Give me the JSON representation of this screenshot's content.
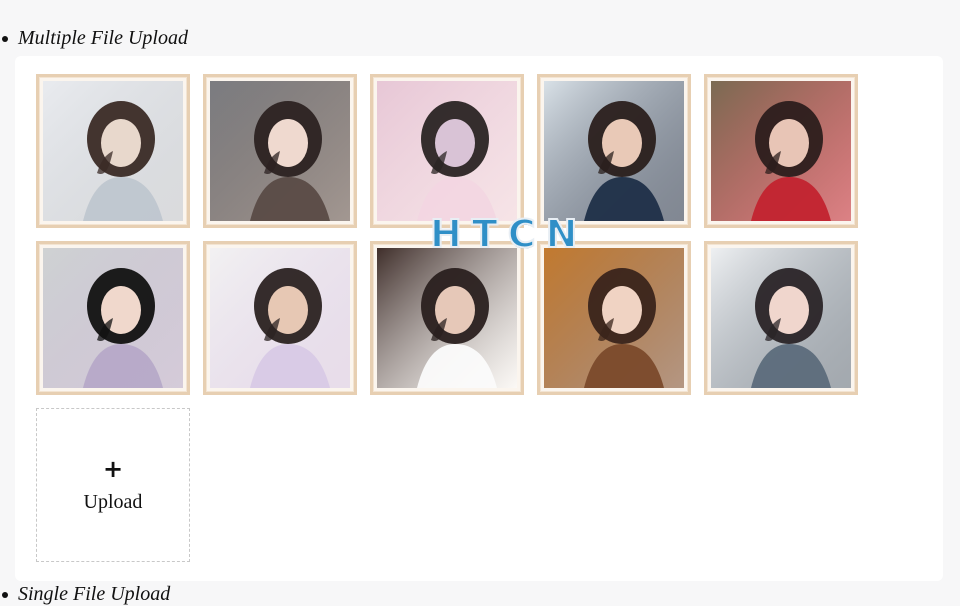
{
  "sections": {
    "multiple": {
      "title": "Multiple File Upload"
    },
    "single": {
      "title": "Single File Upload"
    }
  },
  "gallery": {
    "items": [
      {
        "name": "photo-1",
        "colors": [
          "#e9ebef",
          "#bfc6cf",
          "#3a2a25",
          "#e8d8cc"
        ]
      },
      {
        "name": "photo-2",
        "colors": [
          "#7b7c80",
          "#5a4b46",
          "#2c2221",
          "#efd9cf"
        ]
      },
      {
        "name": "photo-3",
        "colors": [
          "#e7c7d6",
          "#f2d6e1",
          "#2a2423",
          "#d9c3d6"
        ]
      },
      {
        "name": "photo-4",
        "colors": [
          "#d9e1e7",
          "#1f2f48",
          "#2a1f1c",
          "#e9c9b7"
        ]
      },
      {
        "name": "photo-5",
        "colors": [
          "#7a6b52",
          "#c2232f",
          "#2c1e1c",
          "#e8c5b6"
        ]
      },
      {
        "name": "photo-6",
        "colors": [
          "#cfd2d3",
          "#b6a9c8",
          "#111111",
          "#f0d8cc"
        ]
      },
      {
        "name": "photo-7",
        "colors": [
          "#f2f1f2",
          "#d8c9e6",
          "#2b2221",
          "#e7c8b4"
        ]
      },
      {
        "name": "photo-8",
        "colors": [
          "#3f2e2a",
          "#fbfbfb",
          "#2a201f",
          "#e6c8b8"
        ]
      },
      {
        "name": "photo-9",
        "colors": [
          "#c27a2f",
          "#7b4a2b",
          "#3a241b",
          "#f0d3c3"
        ]
      },
      {
        "name": "photo-10",
        "colors": [
          "#eef0f2",
          "#5c6b7b",
          "#2a2427",
          "#f0d6cd"
        ]
      }
    ]
  },
  "upload": {
    "icon": "plus-icon",
    "label": "Upload"
  },
  "watermark": {
    "text": "HTCN",
    "color": "#2f8fc7"
  }
}
